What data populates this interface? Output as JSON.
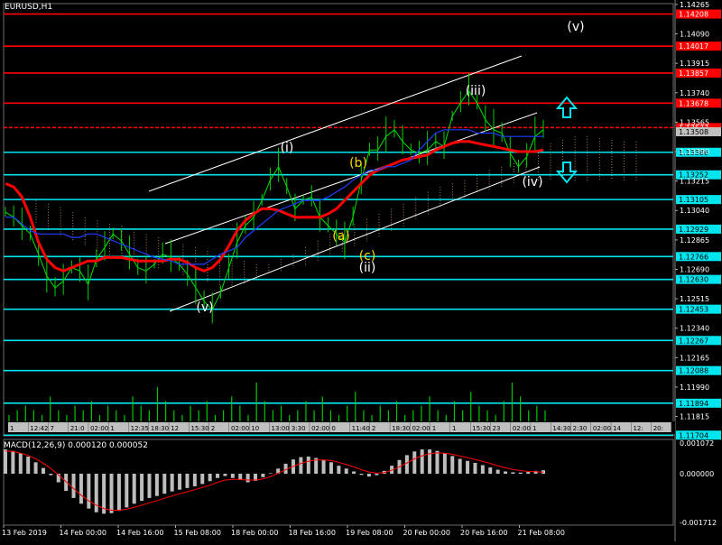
{
  "symbol_label": "EURUSD,H1",
  "macd_label": "MACD(12,26,9) 0.000120 0.000052",
  "chart_data": [
    {
      "type": "line",
      "title": "EURUSD,H1",
      "ylim": [
        1.117,
        1.1427
      ],
      "y_ticks": [
        "1.14265",
        "1.14090",
        "1.13915",
        "1.13740",
        "1.13565",
        "1.13390",
        "1.13215",
        "1.13040",
        "1.12865",
        "1.12690",
        "1.12515",
        "1.12340",
        "1.12165",
        "1.11990",
        "1.11815"
      ],
      "x_tick_labels": [
        "13 Feb 2019",
        "14 Feb 00:00",
        "14 Feb 16:00",
        "15 Feb 08:00",
        "18 Feb 00:00",
        "18 Feb 16:00",
        "19 Feb 08:00",
        "20 Feb 00:00",
        "20 Feb 16:00",
        "21 Feb 08:00"
      ],
      "horizontal_levels": [
        {
          "value": "1.14208",
          "color": "#ff0000"
        },
        {
          "value": "1.14017",
          "color": "#ff0000"
        },
        {
          "value": "1.13857",
          "color": "#ff0000"
        },
        {
          "value": "1.13678",
          "color": "#ff0000"
        },
        {
          "value": "1.13533",
          "color": "#ff0000"
        },
        {
          "value": "1.13386",
          "color": "#00e5ee"
        },
        {
          "value": "1.13252",
          "color": "#00e5ee"
        },
        {
          "value": "1.13105",
          "color": "#00e5ee"
        },
        {
          "value": "1.12929",
          "color": "#00e5ee"
        },
        {
          "value": "1.12766",
          "color": "#00e5ee"
        },
        {
          "value": "1.12630",
          "color": "#00e5ee"
        },
        {
          "value": "1.12453",
          "color": "#00e5ee"
        },
        {
          "value": "1.12267",
          "color": "#00e5ee"
        },
        {
          "value": "1.12088",
          "color": "#00e5ee"
        },
        {
          "value": "1.11894",
          "color": "#00e5ee"
        },
        {
          "value": "1.11704",
          "color": "#00e5ee"
        }
      ],
      "current_price": "1.13508",
      "wave_labels": [
        {
          "text": "(v)",
          "color": "#ffffff"
        },
        {
          "text": "(i)",
          "color": "#ffffff"
        },
        {
          "text": "(b)",
          "color": "#ffd700"
        },
        {
          "text": "(a)",
          "color": "#ffd700"
        },
        {
          "text": "(c)",
          "color": "#ffd700"
        },
        {
          "text": "(ii)",
          "color": "#ffffff"
        },
        {
          "text": "(iii)",
          "color": "#ffffff"
        },
        {
          "text": "(iv)",
          "color": "#ffffff"
        },
        {
          "text": "(v)",
          "color": "#ffffff"
        }
      ],
      "arrows": [
        {
          "name": "up-arrow",
          "direction": "up",
          "color": "#00e5ee"
        },
        {
          "name": "down-arrow",
          "direction": "down",
          "color": "#00e5ee"
        }
      ],
      "price_close": [
        1.1303,
        1.13,
        1.1295,
        1.129,
        1.1278,
        1.1265,
        1.1258,
        1.1262,
        1.127,
        1.1268,
        1.126,
        1.1275,
        1.1282,
        1.129,
        1.1286,
        1.1278,
        1.127,
        1.1268,
        1.1272,
        1.1278,
        1.1276,
        1.1272,
        1.1266,
        1.1258,
        1.125,
        1.1245,
        1.1255,
        1.127,
        1.1285,
        1.1295,
        1.13,
        1.131,
        1.1322,
        1.133,
        1.1318,
        1.1305,
        1.131,
        1.1312,
        1.13,
        1.1295,
        1.129,
        1.1285,
        1.13,
        1.1322,
        1.134,
        1.134,
        1.1348,
        1.1352,
        1.1345,
        1.134,
        1.1338,
        1.134,
        1.1345,
        1.1342,
        1.136,
        1.1368,
        1.1375,
        1.1368,
        1.1358,
        1.1352,
        1.135,
        1.1338,
        1.133,
        1.1336,
        1.1348,
        1.1352
      ],
      "series": [
        {
          "name": "",
          "color": "#ff0000",
          "values": [
            1.132,
            1.1318,
            1.1312,
            1.13,
            1.1285,
            1.1275,
            1.127,
            1.1268,
            1.127,
            1.1272,
            1.1274,
            1.1274,
            1.1276,
            1.1276,
            1.1276,
            1.1275,
            1.1274,
            1.1274,
            1.1274,
            1.1274,
            1.1275,
            1.1275,
            1.1273,
            1.127,
            1.1268,
            1.127,
            1.1275,
            1.1283,
            1.1292,
            1.1298,
            1.1302,
            1.1305,
            1.1305,
            1.1304,
            1.1302,
            1.13,
            1.13,
            1.13,
            1.13,
            1.1302,
            1.1305,
            1.131,
            1.1315,
            1.132,
            1.1325,
            1.1328,
            1.133,
            1.1332,
            1.1334,
            1.1335,
            1.1336,
            1.1337,
            1.134,
            1.1342,
            1.1344,
            1.1345,
            1.1345,
            1.1344,
            1.1343,
            1.1342,
            1.1341,
            1.134,
            1.1339,
            1.1339,
            1.1339,
            1.134
          ]
        },
        {
          "name": "",
          "color": "#1e3cff",
          "values": [
            1.13,
            1.13,
            1.1296,
            1.1292,
            1.129,
            1.129,
            1.129,
            1.129,
            1.1288,
            1.1288,
            1.129,
            1.129,
            1.1288,
            1.1286,
            1.1284,
            1.1282,
            1.128,
            1.1278,
            1.1276,
            1.1275,
            1.1274,
            1.1272,
            1.1272,
            1.1272,
            1.1272,
            1.1275,
            1.1278,
            1.128,
            1.1282,
            1.1288,
            1.1292,
            1.1296,
            1.13,
            1.1304,
            1.1306,
            1.1308,
            1.131,
            1.131,
            1.131,
            1.1312,
            1.1315,
            1.1318,
            1.1322,
            1.1325,
            1.1328,
            1.1328,
            1.133,
            1.133,
            1.1332,
            1.1334,
            1.134,
            1.1345,
            1.135,
            1.1352,
            1.1352,
            1.1352,
            1.1352,
            1.135,
            1.135,
            1.135,
            1.1348,
            1.1348,
            1.1348,
            1.1348,
            1.1348,
            1.1348
          ]
        }
      ],
      "cloud_top": [
        1.131,
        1.1308,
        1.1306,
        1.1303,
        1.13,
        1.1298,
        1.1296,
        1.1295,
        1.1293,
        1.129,
        1.1288,
        1.1286,
        1.1284,
        1.1282,
        1.128,
        1.1278,
        1.1276,
        1.1274,
        1.1272,
        1.1272,
        1.1275,
        1.1278,
        1.1282,
        1.1286,
        1.129,
        1.1293,
        1.1296,
        1.1299,
        1.1302,
        1.1305,
        1.1308,
        1.1312,
        1.1315,
        1.1318,
        1.132,
        1.1322,
        1.1325,
        1.1328,
        1.133,
        1.1332,
        1.1335,
        1.134,
        1.1344,
        1.1346,
        1.1348,
        1.1348,
        1.1347,
        1.1346,
        1.1345,
        1.1345
      ],
      "cloud_bottom": [
        1.13,
        1.1297,
        1.1293,
        1.129,
        1.1287,
        1.1284,
        1.1282,
        1.128,
        1.1278,
        1.1276,
        1.1274,
        1.1272,
        1.127,
        1.1268,
        1.1266,
        1.1264,
        1.1263,
        1.1265,
        1.1268,
        1.127,
        1.1272,
        1.1274,
        1.1276,
        1.1278,
        1.1281,
        1.1284,
        1.1287,
        1.129,
        1.1293,
        1.1296,
        1.1299,
        1.1303,
        1.1306,
        1.131,
        1.1313,
        1.1316,
        1.1318,
        1.132,
        1.1322,
        1.1324,
        1.1326,
        1.1326,
        1.1326,
        1.1326,
        1.1326,
        1.1326,
        1.1326,
        1.1326,
        1.1326,
        1.1326
      ],
      "volume": [
        2,
        3,
        4,
        3,
        2,
        6,
        3,
        2,
        4,
        3,
        5,
        2,
        4,
        3,
        2,
        6,
        4,
        3,
        8,
        5,
        3,
        2,
        4,
        3,
        5,
        2,
        3,
        6,
        4,
        2,
        9,
        5,
        3,
        4,
        2,
        3,
        5,
        3,
        6,
        3,
        2,
        4,
        7,
        3,
        2,
        4,
        3,
        5,
        2,
        3,
        4,
        6,
        3,
        2,
        5,
        3,
        7,
        4,
        3,
        2,
        5,
        9,
        6,
        3,
        4,
        3
      ],
      "volume_labels": [
        "1",
        "12:42",
        "7",
        "21:0",
        "02:00",
        "1",
        "12:35",
        "18:30",
        "12",
        "15:30",
        "2",
        "02:00",
        "10",
        "13:00",
        "3:30",
        "02:00",
        "0",
        "11:40",
        "2",
        "18:30",
        "02:00",
        "1",
        "1",
        "15:30",
        "23",
        "02:00",
        "1",
        "14:30",
        "2:30",
        "02:00",
        "14",
        "12:",
        "20:"
      ]
    },
    {
      "type": "bar",
      "title": "MACD(12,26,9) 0.000120 0.000052",
      "y_ticks": [
        "0.001072",
        "0.000000",
        "-0.001712"
      ],
      "ylim": [
        -0.0018,
        0.0012
      ],
      "series": [
        {
          "name": "",
          "color": "#bdbdbd",
          "values": [
            0.00085,
            0.0008,
            0.00072,
            0.0006,
            0.0004,
            0.0002,
            -5e-05,
            -0.0003,
            -0.0006,
            -0.00085,
            -0.00105,
            -0.00122,
            -0.00135,
            -0.0014,
            -0.00138,
            -0.0013,
            -0.00118,
            -0.00105,
            -0.00095,
            -0.00085,
            -0.00078,
            -0.0007,
            -0.00062,
            -0.00056,
            -0.0005,
            -0.00044,
            -0.00036,
            -0.00026,
            -0.00015,
            -8e-05,
            -0.00015,
            -0.00022,
            -0.0003,
            -0.00025,
            -0.00012,
            2e-05,
            0.00018,
            0.00035,
            0.0005,
            0.00058,
            0.0006,
            0.00055,
            0.00048,
            0.0004,
            0.00028,
            0.00018,
            8e-05,
            -4e-05,
            -0.0001,
            -5e-05,
            0.0001,
            0.00028,
            0.00048,
            0.00065,
            0.00078,
            0.00085,
            0.00085,
            0.0008,
            0.00072,
            0.00062,
            0.00052,
            0.00045,
            0.00038,
            0.0003,
            0.00022,
            0.00014,
            8e-05,
            5e-05,
            4e-05,
            6e-05,
            0.0001,
            0.00012
          ]
        },
        {
          "name": "",
          "color": "#ff0000",
          "values": [
            0.0008,
            0.00078,
            0.00072,
            0.00064,
            0.00052,
            0.00036,
            0.00018,
            -4e-05,
            -0.00028,
            -0.00052,
            -0.00075,
            -0.00095,
            -0.0011,
            -0.00122,
            -0.00128,
            -0.00128,
            -0.00124,
            -0.00118,
            -0.0011,
            -0.00102,
            -0.00094,
            -0.00086,
            -0.00078,
            -0.0007,
            -0.00063,
            -0.00056,
            -0.00048,
            -0.0004,
            -0.0003,
            -0.00022,
            -0.0002,
            -0.0002,
            -0.00022,
            -0.00022,
            -0.00018,
            -0.0001,
            2e-05,
            0.00014,
            0.00026,
            0.00036,
            0.00044,
            0.00048,
            0.00048,
            0.00046,
            0.0004,
            0.00032,
            0.00024,
            0.00014,
            6e-05,
            2e-05,
            4e-05,
            0.00012,
            0.00024,
            0.00038,
            0.00052,
            0.00063,
            0.0007,
            0.00073,
            0.00072,
            0.00068,
            0.00062,
            0.00056,
            0.0005,
            0.00043,
            0.00036,
            0.00028,
            0.00021,
            0.00015,
            0.00011,
            8e-05,
            7e-05,
            5e-05
          ]
        }
      ],
      "x_tick_labels": [
        "13 Feb 2019",
        "14 Feb 00:00",
        "14 Feb 16:00",
        "15 Feb 08:00",
        "18 Feb 00:00",
        "18 Feb 16:00",
        "19 Feb 08:00",
        "20 Feb 00:00",
        "20 Feb 16:00",
        "21 Feb 08:00"
      ]
    }
  ]
}
